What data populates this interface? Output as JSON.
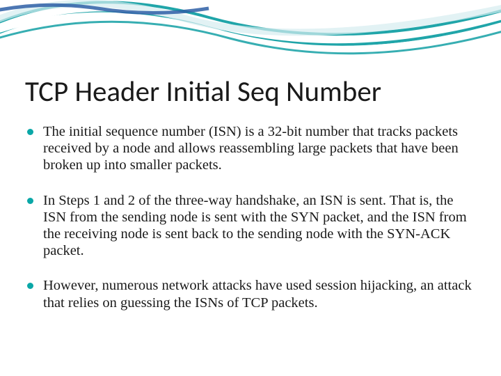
{
  "slide": {
    "title": "TCP Header Initial Seq Number",
    "bullets": [
      "The initial sequence number (ISN) is a 32-bit number that tracks packets received by a node and allows reassembling large packets that have been broken up into smaller packets.",
      "In Steps 1 and 2 of the three-way handshake, an ISN is sent. That is, the ISN from the sending node is sent with the SYN packet, and the ISN from the receiving node is sent back to the sending node with the SYN-ACK packet.",
      "However, numerous network attacks have used session hijacking, an attack that relies on guessing the ISNs of TCP packets."
    ]
  },
  "theme": {
    "accent": "#0aa7a7",
    "swoosh_teal": "#14a0a4",
    "swoosh_blue": "#2e5fa6"
  }
}
